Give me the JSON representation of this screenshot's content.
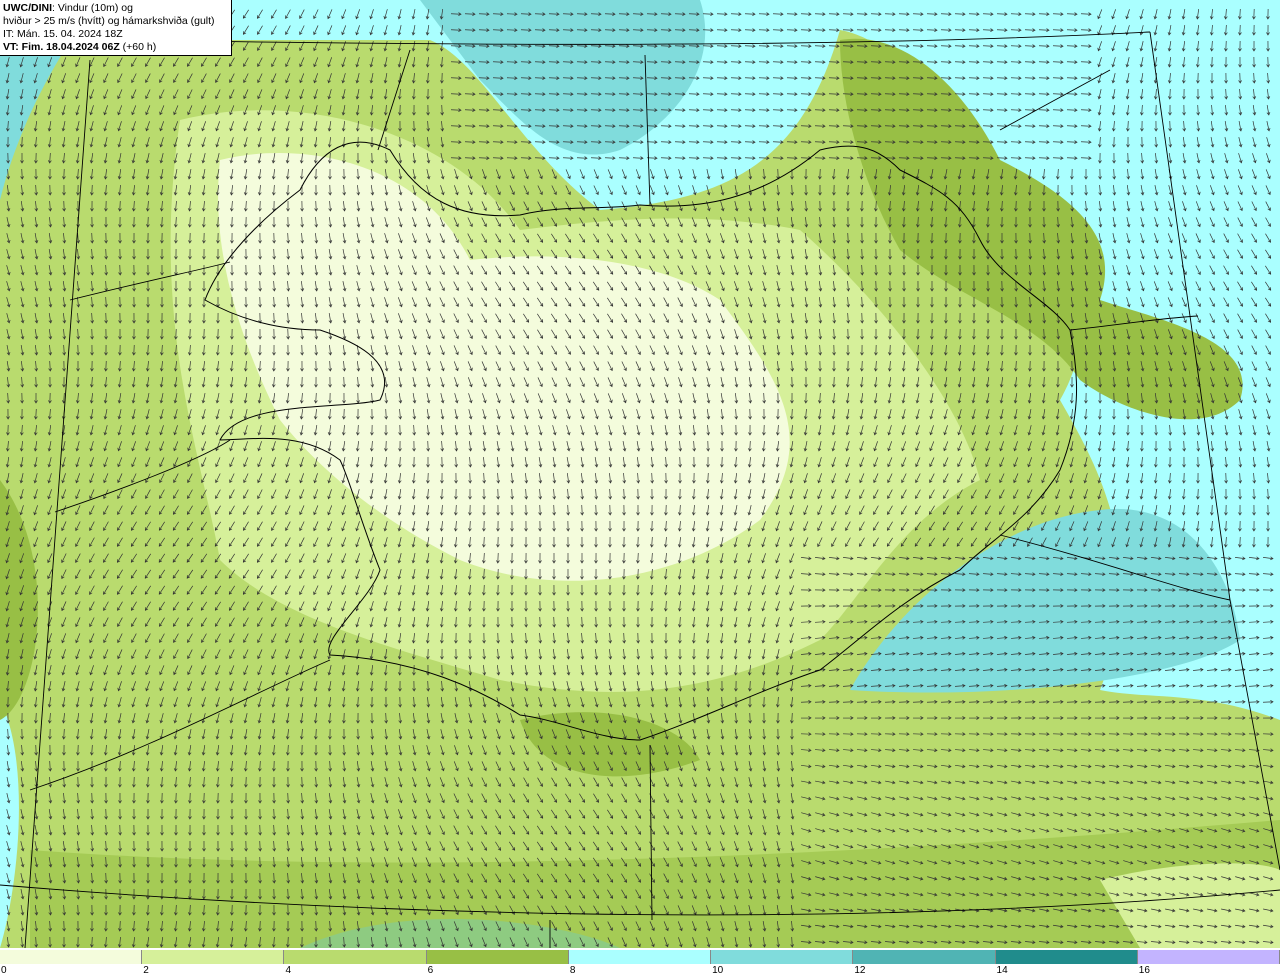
{
  "title": {
    "source": "UWC/DINI",
    "line1_rest": ": Vindur (10m) og",
    "line2": "hviður > 25 m/s (hvítt) og hámarkshviða (gult)",
    "line3": "IT: Mán. 15. 04. 2024 18Z",
    "line4_bold": "VT: Fim. 18.04.2024 06Z",
    "line4_rest": " (+60 h)"
  },
  "legend": {
    "colors": [
      "#f4fcdc",
      "#d6f09a",
      "#b9db6e",
      "#98bf45",
      "#aaffff",
      "#80dcdc",
      "#50b4b4",
      "#208c8c",
      "#c3b4ff"
    ],
    "ticks": [
      "0",
      "2",
      "4",
      "6",
      "8",
      "10",
      "12",
      "14",
      "16"
    ]
  },
  "map_colors": {
    "sea_light": "#aaffff",
    "sea_mid": "#80dcdc",
    "sea_dark": "#50b4b4",
    "land_light": "#f4fcdc",
    "land_mid": "#d6f09a",
    "land_dark": "#b9db6e",
    "wind_dark": "#98bf45"
  }
}
